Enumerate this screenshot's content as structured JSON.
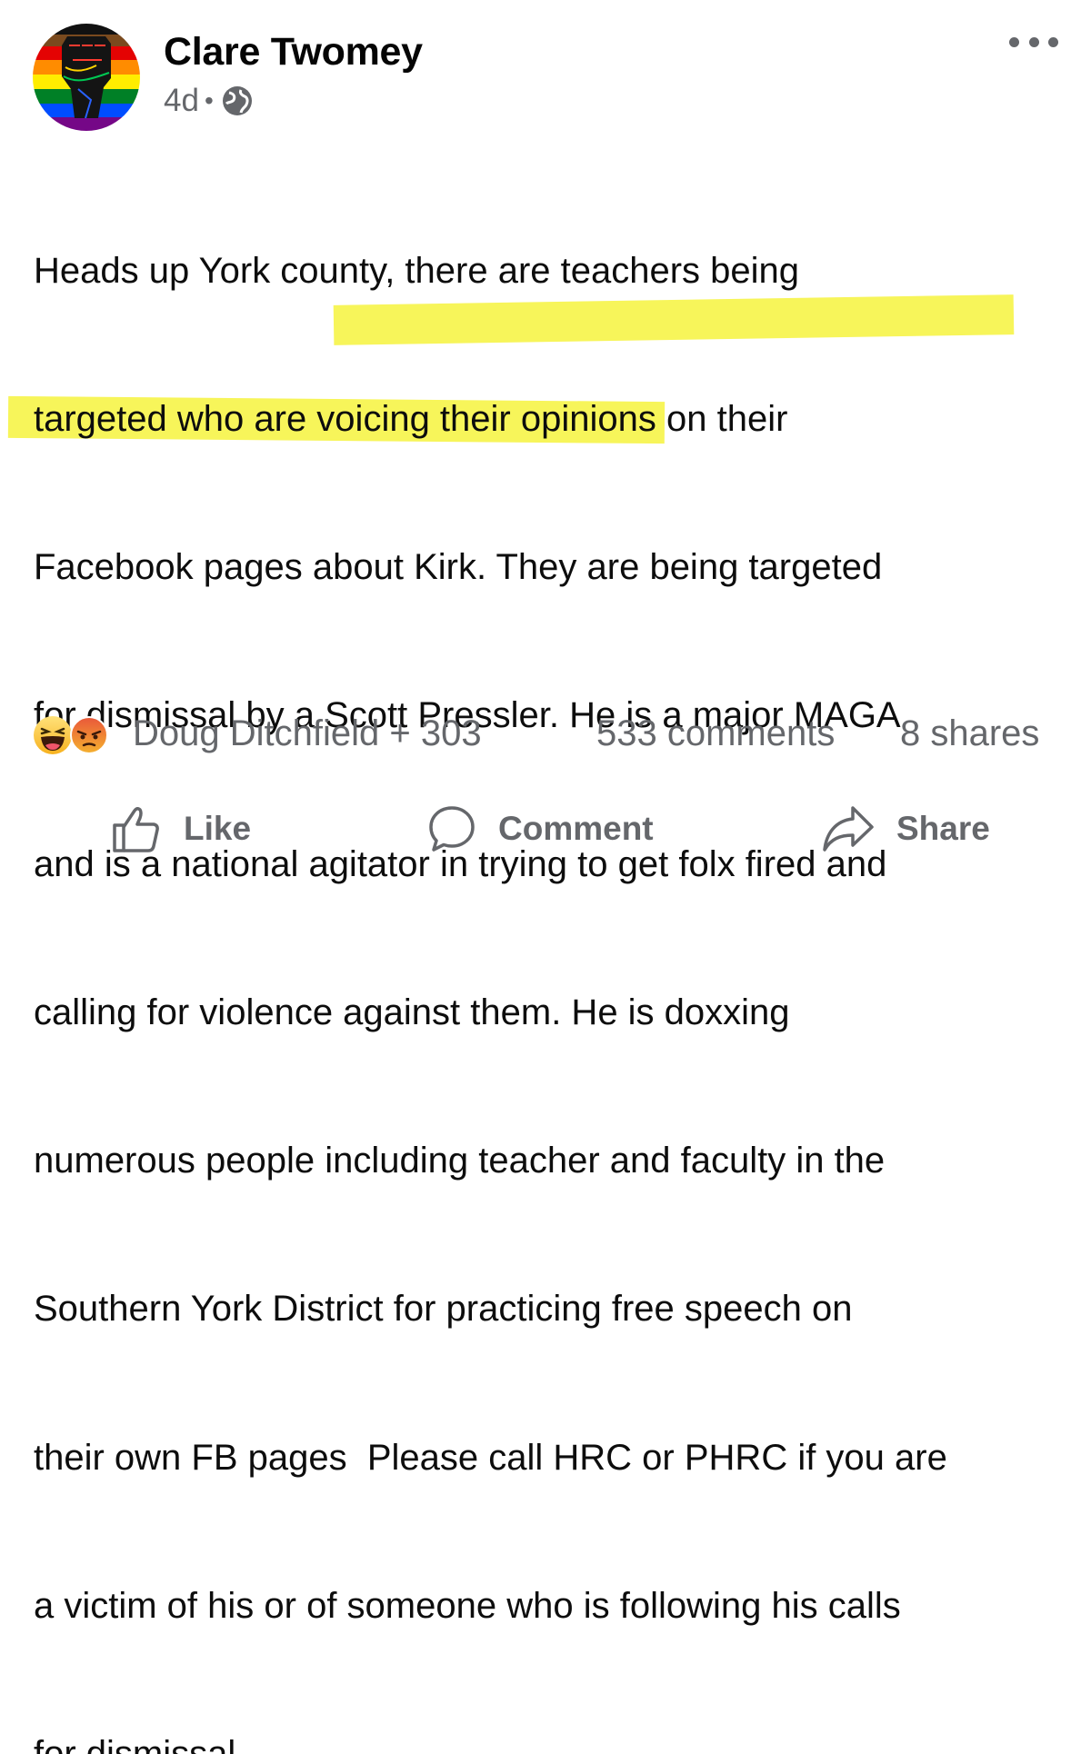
{
  "post": {
    "author": "Clare Twomey",
    "time": "4d",
    "privacy_icon": "globe-icon",
    "more_icon": "more-options-icon",
    "lines": [
      "Heads up York county, there are teachers being",
      "targeted who are voicing their opinions on their",
      "Facebook pages about Kirk. They are being targeted",
      "for dismissal by a Scott Pressler. He is a major MAGA",
      "and is a national agitator in trying to get folx fired and",
      "calling for violence against them. He is doxxing",
      "numerous people including teacher and faculty in the",
      "Southern York District for practicing free speech on",
      "their own FB pages  Please call HRC or PHRC if you are",
      "a victim of his or of someone who is following his calls",
      "for dismissal."
    ],
    "highlight_color": "#f7f55a"
  },
  "stats": {
    "reaction_icons": [
      "haha-reaction-icon",
      "angry-reaction-icon"
    ],
    "reactors": "Doug Ditchfield + 303",
    "comments": "533 comments",
    "shares": "8 shares"
  },
  "actions": {
    "like": "Like",
    "comment": "Comment",
    "share": "Share"
  },
  "colors": {
    "secondary_text": "#65676b",
    "primary_text": "#050505"
  }
}
